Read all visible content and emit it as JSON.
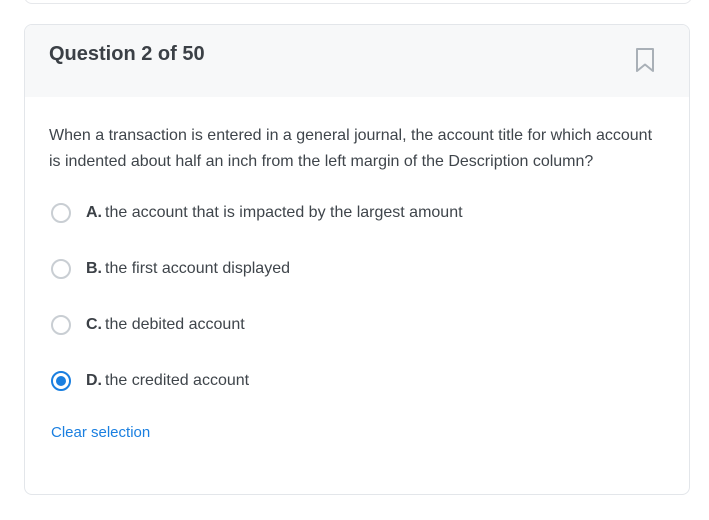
{
  "question": {
    "title": "Question 2 of 50",
    "text": "When a transaction is entered in a general journal, the account title for which account is indented about half an inch from the left margin of the Description column?",
    "bookmark_icon": "bookmark-icon",
    "options": [
      {
        "letter": "A.",
        "text": "the account that is impacted by the largest amount",
        "selected": false
      },
      {
        "letter": "B.",
        "text": "the first account displayed",
        "selected": false
      },
      {
        "letter": "C.",
        "text": "the debited account",
        "selected": false
      },
      {
        "letter": "D.",
        "text": "the credited account",
        "selected": true
      }
    ],
    "clear_label": "Clear selection"
  },
  "colors": {
    "accent": "#1a7fe0",
    "header_bg": "#f7f8f9",
    "text": "#3f454b",
    "radio_border": "#c9ced3"
  }
}
